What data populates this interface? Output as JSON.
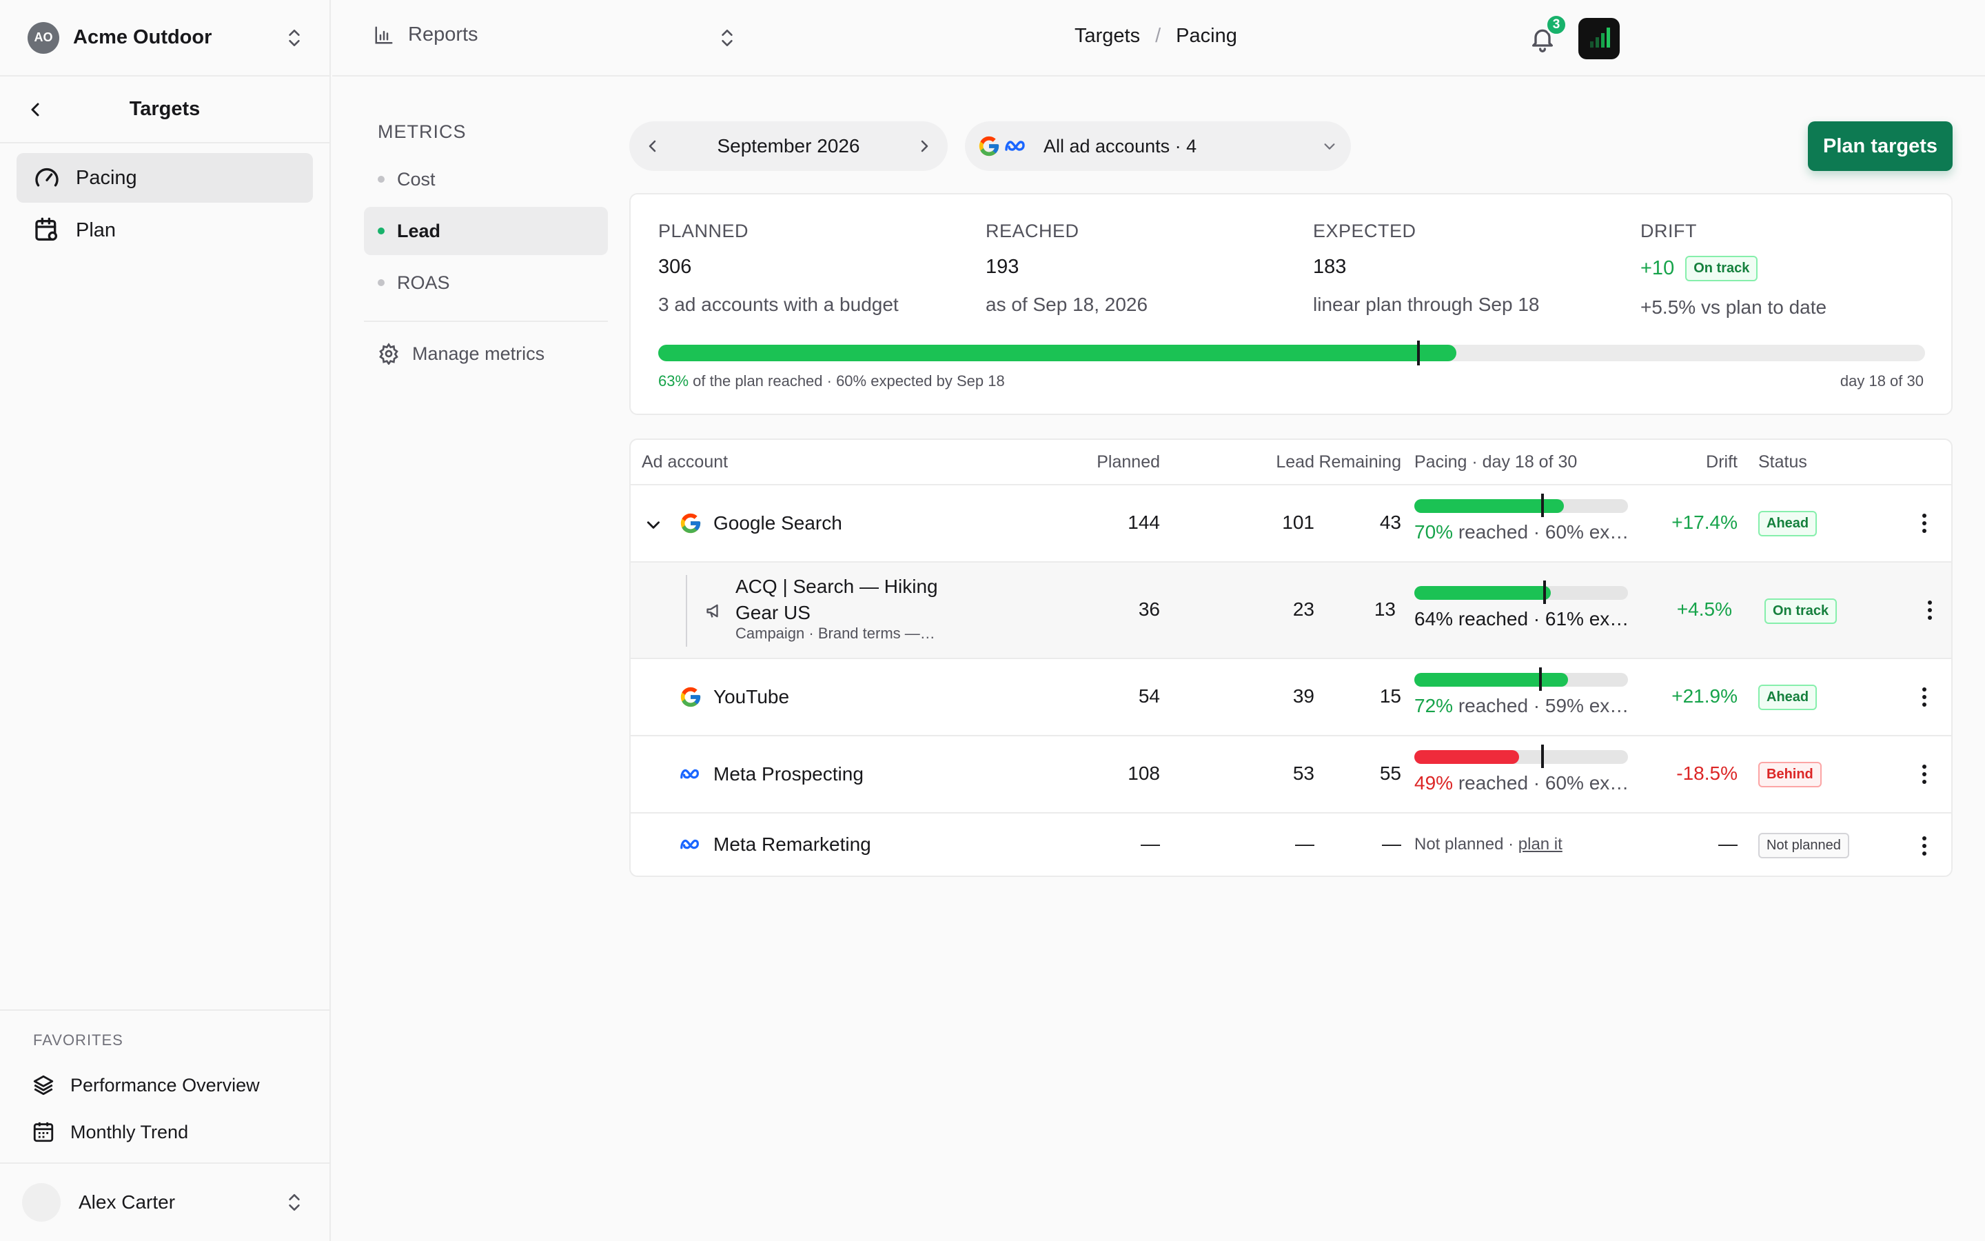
{
  "workspace": {
    "initials": "AO",
    "name": "Acme Outdoor"
  },
  "sidebar": {
    "title": "Targets",
    "items": [
      {
        "label": "Pacing",
        "icon": "gauge-icon",
        "active": true
      },
      {
        "label": "Plan",
        "icon": "calendar-settings-icon",
        "active": false
      }
    ],
    "favorites_title": "FAVORITES",
    "favorites": [
      {
        "label": "Performance Overview",
        "icon": "layers-icon"
      },
      {
        "label": "Monthly Trend",
        "icon": "calendar-icon"
      }
    ],
    "user": {
      "name": "Alex Carter"
    }
  },
  "topbar": {
    "reports_label": "Reports",
    "breadcrumb": [
      "Targets",
      "Pacing"
    ],
    "notifications_count": "3"
  },
  "metrics": {
    "title": "METRICS",
    "items": [
      {
        "label": "Cost",
        "active": false
      },
      {
        "label": "Lead",
        "active": true
      },
      {
        "label": "ROAS",
        "active": false
      }
    ],
    "manage_label": "Manage metrics"
  },
  "controls": {
    "month": "September 2026",
    "accounts": "All ad accounts · 4",
    "plan_button": "Plan targets"
  },
  "summary": {
    "planned": {
      "label": "PLANNED",
      "value": "306",
      "sub": "3 ad accounts with a budget"
    },
    "reached": {
      "label": "REACHED",
      "value": "193",
      "sub": "as of Sep 18, 2026"
    },
    "expected": {
      "label": "EXPECTED",
      "value": "183",
      "sub": "linear plan through Sep 18"
    },
    "drift": {
      "label": "DRIFT",
      "value": "+10",
      "badge": "On track",
      "sub": "+5.5% vs plan to date"
    },
    "progress": {
      "reached_fraction": 0.63,
      "expected_fraction": 0.6
    },
    "caption_pct": "63%",
    "caption_rest": " of the plan reached · 60% expected by Sep 18",
    "caption_right": "day 18 of 30"
  },
  "table": {
    "headers": {
      "account": "Ad account",
      "planned": "Planned",
      "lead": "Lead",
      "remaining": "Remaining",
      "pacing": "Pacing · day 18 of 30",
      "drift": "Drift",
      "status": "Status"
    },
    "rows": [
      {
        "name": "Google Search",
        "planned": "144",
        "lead": "101",
        "remaining": "43",
        "pct": "70%",
        "rest": " reached · 60% ex…",
        "reached": 0.7,
        "expected": 0.6,
        "drift": "+17.4%",
        "status": "Ahead"
      },
      {
        "name": "ACQ | Search — Hiking",
        "name2": "Gear US",
        "meta": "Campaign · Brand terms —…",
        "planned": "36",
        "lead": "23",
        "remaining": "13",
        "pct": "64%",
        "rest": " reached · 61% ex…",
        "reached": 0.64,
        "expected": 0.61,
        "drift": "+4.5%",
        "status": "On track"
      },
      {
        "name": "YouTube",
        "planned": "54",
        "lead": "39",
        "remaining": "15",
        "pct": "72%",
        "rest": " reached · 59% ex…",
        "reached": 0.72,
        "expected": 0.59,
        "drift": "+21.9%",
        "status": "Ahead"
      },
      {
        "name": "Meta Prospecting",
        "planned": "108",
        "lead": "53",
        "remaining": "55",
        "pct": "49%",
        "rest": " reached · 60% ex…",
        "reached": 0.49,
        "expected": 0.6,
        "drift": "-18.5%",
        "status": "Behind"
      },
      {
        "name": "Meta Remarketing",
        "planned": "—",
        "lead": "—",
        "remaining": "—",
        "not_planned": "Not planned · ",
        "plan_it": "plan it",
        "drift": "—",
        "status": "Not planned"
      }
    ]
  },
  "colors": {
    "accent": "#0d7a52",
    "green": "#1bc254",
    "red": "#ef2b3b"
  }
}
